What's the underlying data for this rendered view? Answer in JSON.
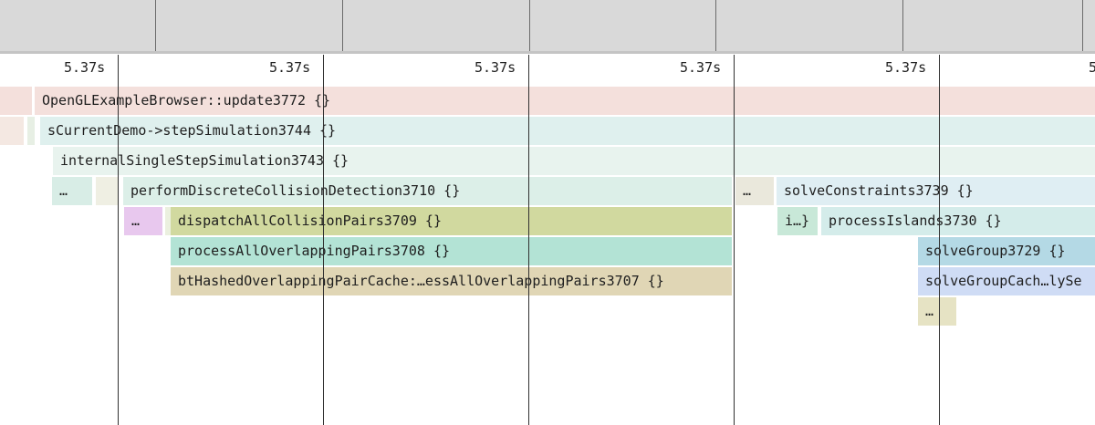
{
  "time_ruler": {
    "ticks": [
      "5.37s",
      "5.37s",
      "5.37s",
      "5.37s",
      "5.37s",
      "5"
    ]
  },
  "flame_frames": [
    {
      "label": "",
      "color": "#f4e0dc"
    },
    {
      "label": "OpenGLExampleBrowser::update3772 {}",
      "color": "#f4e0dc"
    },
    {
      "label": "",
      "color": "#f4e8e2"
    },
    {
      "label": "",
      "color": "#e7efe4"
    },
    {
      "label": "sCurrentDemo->stepSimulation3744 {}",
      "color": "#dff0ee"
    },
    {
      "label": "internalSingleStepSimulation3743 {}",
      "color": "#e8f3ee"
    },
    {
      "label": "…",
      "color": "#d8ede6"
    },
    {
      "label": "",
      "color": "#efefe3"
    },
    {
      "label": "performDiscreteCollisionDetection3710 {}",
      "color": "#dcefe8"
    },
    {
      "label": "…",
      "color": "#eae8dc"
    },
    {
      "label": "solveConstraints3739 {}",
      "color": "#dfeef3"
    },
    {
      "label": "…",
      "color": "#e8c8ee"
    },
    {
      "label": "",
      "color": "#ebf0df"
    },
    {
      "label": "dispatchAllCollisionPairs3709 {}",
      "color": "#d1d99f"
    },
    {
      "label": "i…}",
      "color": "#c8e8d8"
    },
    {
      "label": "processIslands3730 {}",
      "color": "#d4ecea"
    },
    {
      "label": "processAllOverlappingPairs3708 {}",
      "color": "#b3e3d5"
    },
    {
      "label": "solveGroup3729 {}",
      "color": "#b4d9e5"
    },
    {
      "label": "btHashedOverlappingPairCache:…essAllOverlappingPairs3707 {}",
      "color": "#e0d6b5"
    },
    {
      "label": "solveGroupCach…lySe",
      "color": "#cfdcf5"
    },
    {
      "label": "…",
      "color": "#e6e3c4"
    }
  ]
}
